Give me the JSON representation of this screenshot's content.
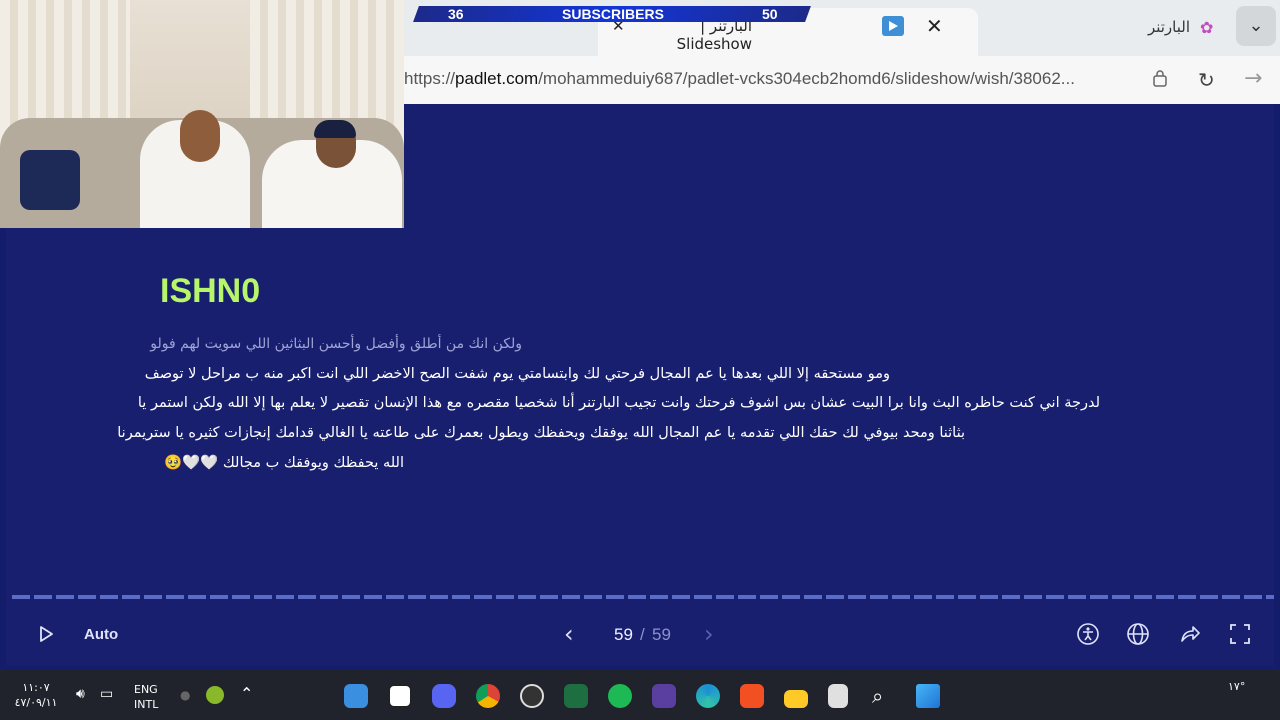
{
  "browser": {
    "tab_title": "البارتنر | Slideshow",
    "profile_name": "البارتنر",
    "url_prefix": "https://",
    "url_domain": "padlet.com",
    "url_path": "/mohammeduiy687/padlet-vcks304ecb2homd6/slideshow/wish/38062..."
  },
  "overlay": {
    "left_count": "36",
    "label": "SUBSCRIBERS",
    "right_count": "50"
  },
  "post": {
    "title": "ISHN0",
    "subtitle": "ولكن انك من أطلق وأفضل وأحسن البثاثين اللي سويت لهم فولو",
    "lines": [
      "ومو مستحقه إلا اللي بعدها يا عم المجال فرحتي لك وابتسامتي يوم شفت الصح الاخضر اللي انت اكبر منه ب مراحل لا توصف",
      "لدرجة اني كنت حاظره البث وانا برا البيت عشان بس اشوف فرحتك وانت تجيب البارتنر أنا شخصيا مقصره مع هذا الإنسان تقصير لا يعلم بها إلا الله ولكن استمر يا",
      "بثاثنا ومحد بيوفي لك حقك اللي تقدمه يا عم المجال الله يوفقك ويحفظك ويطول بعمرك على طاعته يا الغالي قدامك إنجازات كثيره يا ستريمرنا",
      "الله يحفظك ويوفقك ب مجالك 🤍🤍🥹"
    ]
  },
  "controls": {
    "auto_label": "Auto",
    "page_current": "59",
    "page_separator": "/",
    "page_total": "59"
  },
  "taskbar": {
    "clock_time": "١١:٠٧",
    "clock_date": "٤٧/٠٩/١١",
    "lang_line1": "ENG",
    "lang_line2": "INTL",
    "weather": "١٧°"
  },
  "colors": {
    "slide_bg": "#181f6f",
    "title_accent": "#b7f56a",
    "progress": "#5b6bc8"
  }
}
